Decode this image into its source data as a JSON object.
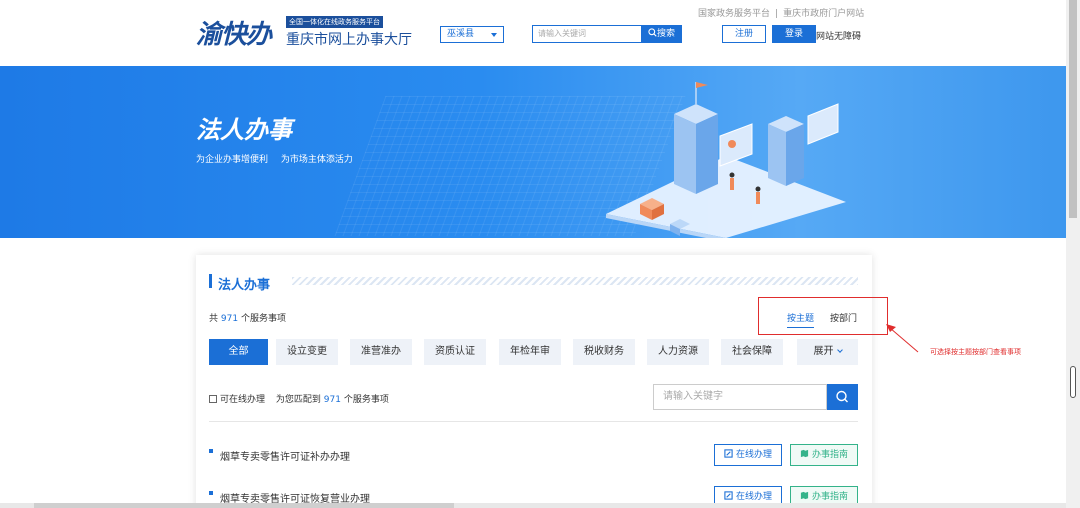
{
  "header": {
    "logo_main": "渝快办",
    "logo_tag": "全国一体化在线政务服务平台",
    "logo_sub": "重庆市网上办事大厅",
    "region": "巫溪县",
    "search_placeholder": "请输入关键词",
    "search_button": "搜索",
    "top_links": [
      "国家政务服务平台",
      "重庆市政府门户网站"
    ],
    "top_link_separator": "|",
    "register": "注册",
    "login": "登录",
    "accessibility": "网站无障碍"
  },
  "banner": {
    "title": "法人办事",
    "subtitles": [
      "为企业办事增便利",
      "为市场主体添活力"
    ]
  },
  "card": {
    "title": "法人办事",
    "count_prefix": "共",
    "count_value": "971",
    "count_suffix": "个服务事项",
    "view_tabs": [
      "按主题",
      "按部门"
    ],
    "categories": [
      "全部",
      "设立变更",
      "准营准办",
      "资质认证",
      "年检年审",
      "税收财务",
      "人力资源",
      "社会保障",
      "展开"
    ],
    "online_only_label": "可在线办理",
    "match_prefix": "为您匹配到",
    "match_value": "971",
    "match_suffix": "个服务事项",
    "keyword_placeholder": "请输入关键字",
    "items": [
      {
        "name": "烟草专卖零售许可证补办办理",
        "online": "在线办理",
        "guide": "办事指南"
      },
      {
        "name": "烟草专卖零售许可证恢复营业办理",
        "online": "在线办理",
        "guide": "办事指南"
      }
    ]
  },
  "annotation": {
    "text": "可选择按主题按部门查看事项",
    "color": "#e02d2d"
  },
  "colors": {
    "primary": "#1b6fd6",
    "brand_dark": "#1b4f9c",
    "guide_green": "#34b38a"
  }
}
